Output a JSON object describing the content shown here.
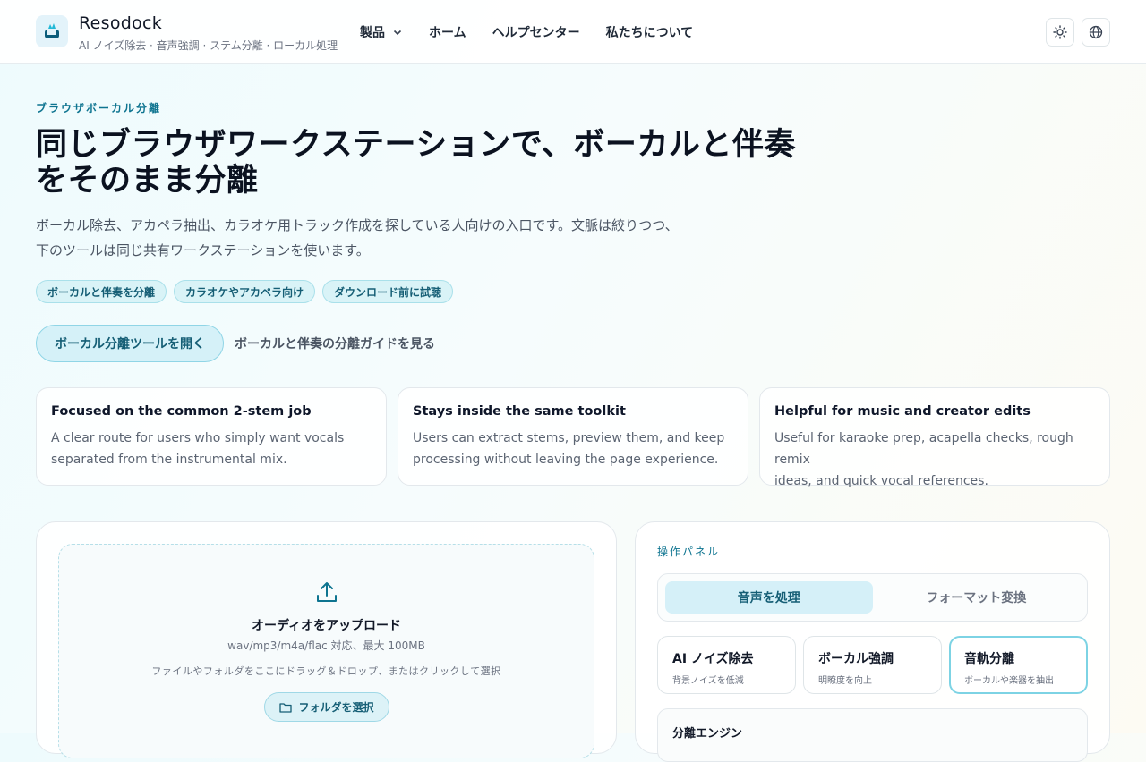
{
  "header": {
    "brand": "Resodock",
    "tagline": "AI ノイズ除去 · 音声強調 · ステム分離 · ローカル処理",
    "nav": [
      "製品",
      "ホーム",
      "ヘルプセンター",
      "私たちについて"
    ]
  },
  "hero": {
    "eyebrow": "ブラウザボーカル分離",
    "title_line1": "同じブラウザワークステーションで、ボーカルと伴奏",
    "title_line2": "をそのまま分離",
    "desc_line1": "ボーカル除去、アカペラ抽出、カラオケ用トラック作成を探している人向けの入口です。文脈は絞りつつ、",
    "desc_line2": "下のツールは同じ共有ワークステーションを使います。",
    "chips": [
      "ボーカルと伴奏を分離",
      "カラオケやアカペラ向け",
      "ダウンロード前に試聴"
    ],
    "cta_primary": "ボーカル分離ツールを開く",
    "cta_secondary": "ボーカルと伴奏の分離ガイドを見る"
  },
  "features": [
    {
      "title": "Focused on the common 2-stem job",
      "line1": "A clear route for users who simply want vocals",
      "line2": "separated from the instrumental mix."
    },
    {
      "title": "Stays inside the same toolkit",
      "line1": "Users can extract stems, preview them, and keep",
      "line2": "processing without leaving the page experience."
    },
    {
      "title": "Helpful for music and creator edits",
      "line1": "Useful for karaoke prep, acapella checks, rough remix",
      "line2": "ideas, and quick vocal references."
    }
  ],
  "upload": {
    "title": "オーディオをアップロード",
    "formats": "wav/mp3/m4a/flac 対応、最大 100MB",
    "hint": "ファイルやフォルダをここにドラッグ＆ドロップ、またはクリックして選択",
    "folder_button": "フォルダを選択"
  },
  "panel": {
    "label": "操作パネル",
    "tabs": [
      "音声を処理",
      "フォーマット変換"
    ],
    "modes": [
      {
        "title": "AI ノイズ除去",
        "sub": "背景ノイズを低減"
      },
      {
        "title": "ボーカル強調",
        "sub": "明瞭度を向上"
      },
      {
        "title": "音軌分離",
        "sub": "ボーカルや楽器を抽出"
      }
    ],
    "engine_title": "分離エンジン"
  },
  "colors": {
    "accent": "#0e7490",
    "accent_bg": "#d5f1f8"
  }
}
